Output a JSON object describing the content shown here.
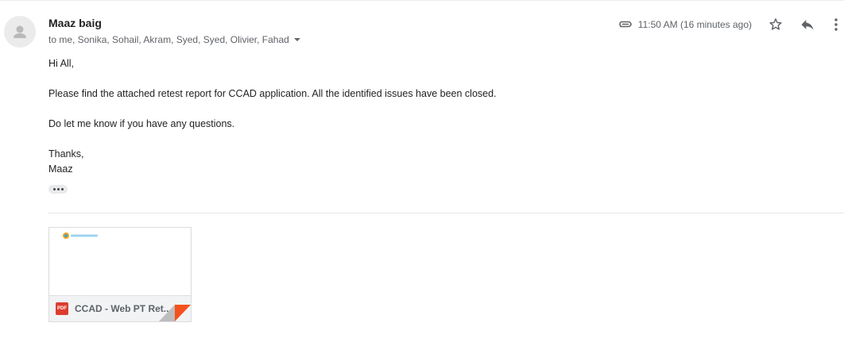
{
  "message": {
    "sender_name": "Maaz baig",
    "recipients_line": "to me, Sonika, Sohail, Akram, Syed, Syed, Olivier, Fahad",
    "timestamp": "11:50 AM (16 minutes ago)",
    "body": {
      "greeting": "Hi All,",
      "paragraph_1": "Please find the attached retest report for CCAD application. All the identified issues have been closed.",
      "paragraph_2": "Do let me know if you have any questions.",
      "closing": "Thanks,",
      "signature": "Maaz"
    },
    "attachment": {
      "file_type_label": "PDF",
      "file_name": "CCAD - Web PT Ret..."
    }
  },
  "icons": {
    "avatar": "default-person-icon",
    "attachment": "paperclip-icon",
    "star": "star-outline-icon",
    "reply": "reply-icon",
    "more": "more-vertical-icon",
    "recipients_toggle": "caret-down-icon",
    "show_trimmed": "ellipsis-icon",
    "file": "pdf-icon"
  },
  "colors": {
    "pdf_red": "#db3d2f",
    "fold_accent": "#f4511e",
    "secondary_text": "#5f6368"
  }
}
